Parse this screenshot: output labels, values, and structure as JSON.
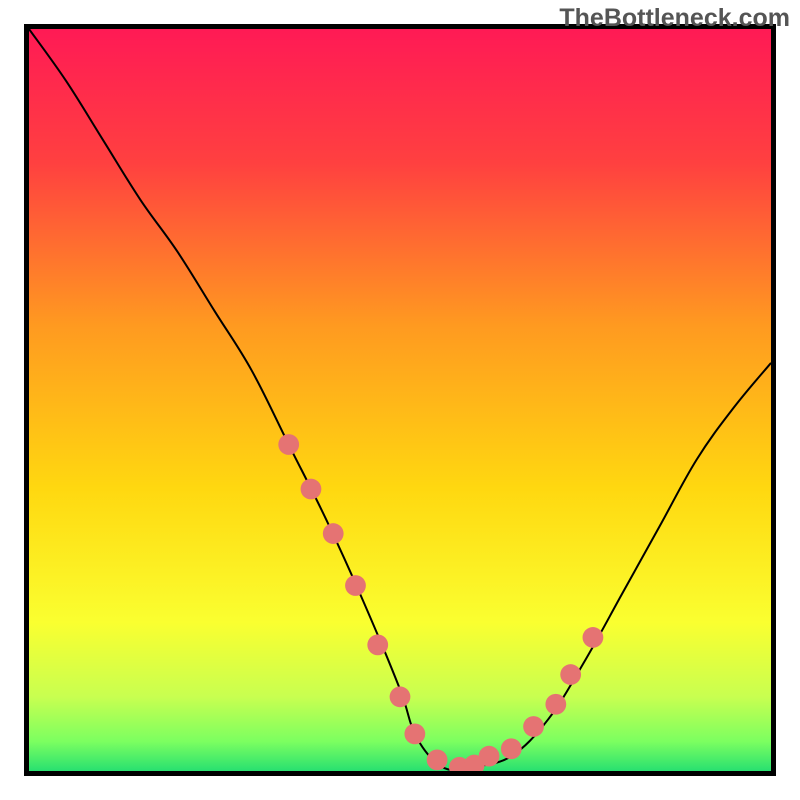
{
  "watermark": "TheBottleneck.com",
  "chart_data": {
    "type": "line",
    "title": "",
    "xlabel": "",
    "ylabel": "",
    "xlim": [
      0,
      100
    ],
    "ylim": [
      0,
      100
    ],
    "series": [
      {
        "name": "curve",
        "x": [
          0,
          5,
          10,
          15,
          20,
          25,
          30,
          35,
          40,
          45,
          50,
          52,
          55,
          58,
          60,
          65,
          70,
          75,
          80,
          85,
          90,
          95,
          100
        ],
        "y": [
          100,
          93,
          85,
          77,
          70,
          62,
          54,
          44,
          34,
          23,
          11,
          5,
          1,
          0,
          0.5,
          2,
          7,
          15,
          24,
          33,
          42,
          49,
          55
        ]
      }
    ],
    "markers": {
      "name": "flat-region-dots",
      "color": "#e57373",
      "points": [
        {
          "x": 35,
          "y": 44
        },
        {
          "x": 38,
          "y": 38
        },
        {
          "x": 41,
          "y": 32
        },
        {
          "x": 44,
          "y": 25
        },
        {
          "x": 47,
          "y": 17
        },
        {
          "x": 50,
          "y": 10
        },
        {
          "x": 52,
          "y": 5
        },
        {
          "x": 55,
          "y": 1.5
        },
        {
          "x": 58,
          "y": 0.5
        },
        {
          "x": 60,
          "y": 0.8
        },
        {
          "x": 62,
          "y": 2
        },
        {
          "x": 65,
          "y": 3
        },
        {
          "x": 68,
          "y": 6
        },
        {
          "x": 71,
          "y": 9
        },
        {
          "x": 73,
          "y": 13
        },
        {
          "x": 76,
          "y": 18
        }
      ]
    },
    "background_gradient": {
      "type": "vertical",
      "stops": [
        {
          "offset": 0,
          "color": "#ff1a55"
        },
        {
          "offset": 0.18,
          "color": "#ff4040"
        },
        {
          "offset": 0.4,
          "color": "#ff9a20"
        },
        {
          "offset": 0.62,
          "color": "#ffd810"
        },
        {
          "offset": 0.8,
          "color": "#faff30"
        },
        {
          "offset": 0.9,
          "color": "#c8ff50"
        },
        {
          "offset": 0.96,
          "color": "#7cff60"
        },
        {
          "offset": 1.0,
          "color": "#28e070"
        }
      ]
    }
  }
}
